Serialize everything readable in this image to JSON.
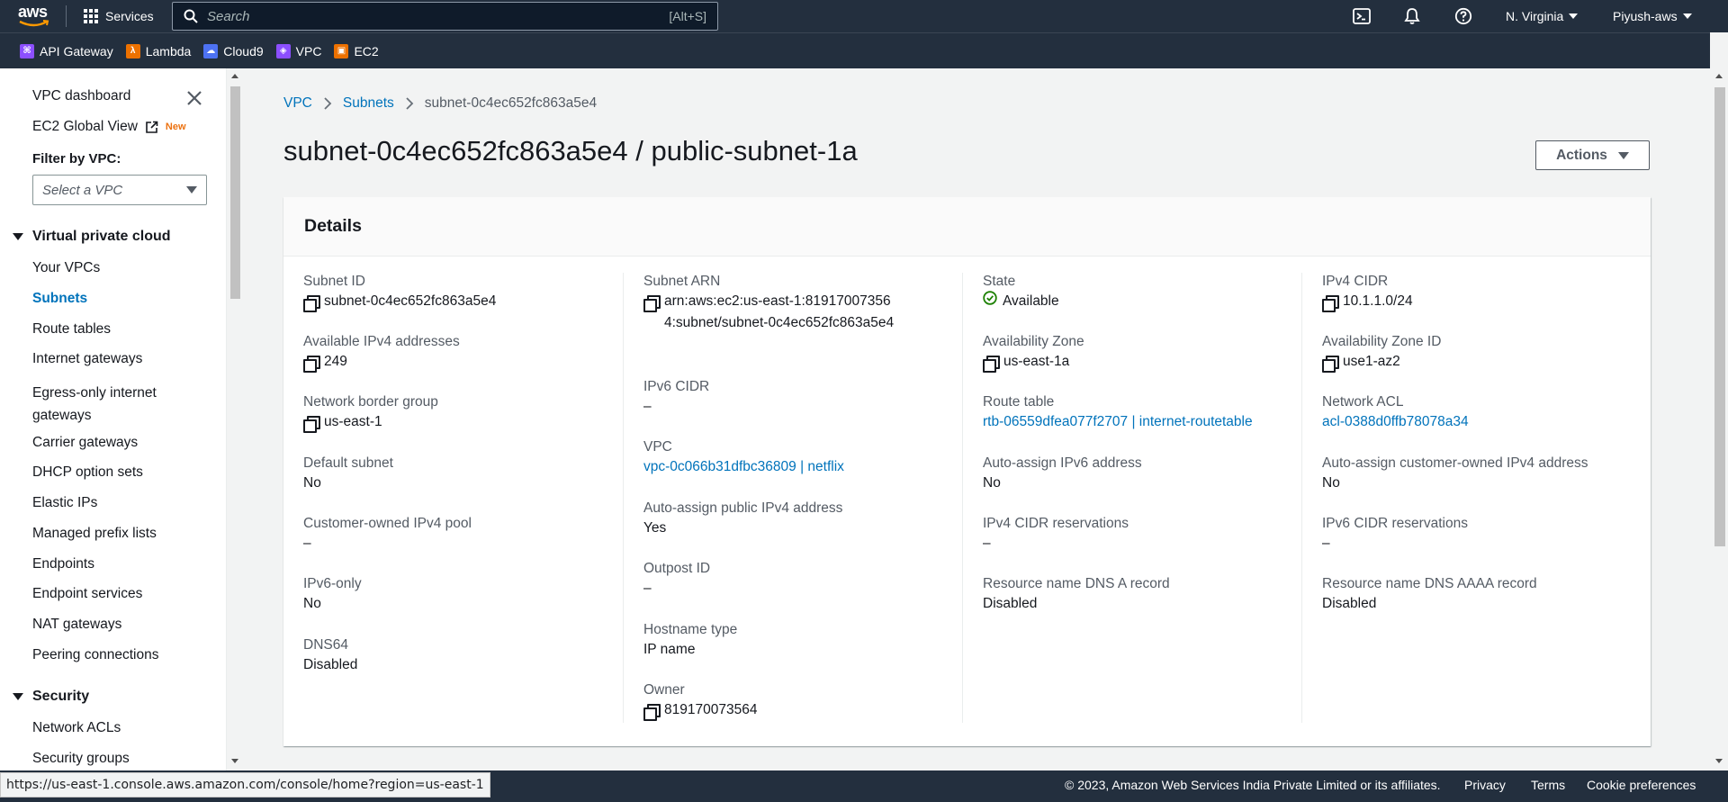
{
  "topbar": {
    "logo": "aws",
    "services_label": "Services",
    "search_placeholder": "Search",
    "search_shortcut": "[Alt+S]",
    "icons": [
      "cloudshell-icon",
      "bell-icon",
      "help-icon"
    ],
    "region": "N. Virginia",
    "account": "Piyush-aws"
  },
  "favorites": [
    {
      "label": "API Gateway",
      "color": "#8c4fff"
    },
    {
      "label": "Lambda",
      "color": "#ed7100"
    },
    {
      "label": "Cloud9",
      "color": "#4d72f3"
    },
    {
      "label": "VPC",
      "color": "#8c4fff"
    },
    {
      "label": "EC2",
      "color": "#ed7100"
    }
  ],
  "sidebar": {
    "dashboard": "VPC dashboard",
    "global_view": "EC2 Global View",
    "new_badge": "New",
    "filter_label": "Filter by VPC:",
    "filter_placeholder": "Select a VPC",
    "section_vpc": "Virtual private cloud",
    "items": [
      "Your VPCs",
      "Subnets",
      "Route tables",
      "Internet gateways",
      "Egress-only internet gateways",
      "Carrier gateways",
      "DHCP option sets",
      "Elastic IPs",
      "Managed prefix lists",
      "Endpoints",
      "Endpoint services",
      "NAT gateways",
      "Peering connections"
    ],
    "active_item": "Subnets",
    "section_security": "Security",
    "security_items": [
      "Network ACLs",
      "Security groups"
    ]
  },
  "breadcrumb": [
    "VPC",
    "Subnets",
    "subnet-0c4ec652fc863a5e4"
  ],
  "page_title": "subnet-0c4ec652fc863a5e4 / public-subnet-1a",
  "actions_label": "Actions",
  "details": {
    "title": "Details",
    "col1": [
      {
        "k": "Subnet ID",
        "v": "subnet-0c4ec652fc863a5e4",
        "copy": true
      },
      {
        "k": "Available IPv4 addresses",
        "v": "249",
        "copy": true
      },
      {
        "k": "Network border group",
        "v": "us-east-1",
        "copy": true
      },
      {
        "k": "Default subnet",
        "v": "No"
      },
      {
        "k": "Customer-owned IPv4 pool",
        "v": "–"
      },
      {
        "k": "IPv6-only",
        "v": "No"
      },
      {
        "k": "DNS64",
        "v": "Disabled"
      }
    ],
    "col2": [
      {
        "k": "Subnet ARN",
        "v": "arn:aws:ec2:us-east-1:819170073564:subnet/subnet-0c4ec652fc863a5e4",
        "copy": true
      },
      {
        "k": "IPv6 CIDR",
        "v": "–"
      },
      {
        "k": "VPC",
        "v": "vpc-0c066b31dfbc36809 | netflix",
        "link": true
      },
      {
        "k": "Auto-assign public IPv4 address",
        "v": "Yes"
      },
      {
        "k": "Outpost ID",
        "v": "–"
      },
      {
        "k": "Hostname type",
        "v": "IP name"
      },
      {
        "k": "Owner",
        "v": "819170073564",
        "copy": true
      }
    ],
    "col3": [
      {
        "k": "State",
        "v": "Available",
        "status": true
      },
      {
        "k": "Availability Zone",
        "v": "us-east-1a",
        "copy": true
      },
      {
        "k": "Route table",
        "v": "rtb-06559dfea077f2707 | internet-routetable",
        "link": true
      },
      {
        "k": "Auto-assign IPv6 address",
        "v": "No"
      },
      {
        "k": "IPv4 CIDR reservations",
        "v": "–"
      },
      {
        "k": "Resource name DNS A record",
        "v": "Disabled"
      }
    ],
    "col4": [
      {
        "k": "IPv4 CIDR",
        "v": "10.1.1.0/24",
        "copy": true
      },
      {
        "k": "Availability Zone ID",
        "v": "use1-az2",
        "copy": true
      },
      {
        "k": "Network ACL",
        "v": "acl-0388d0ffb78078a34",
        "link": true
      },
      {
        "k": "Auto-assign customer-owned IPv4 address",
        "v": "No"
      },
      {
        "k": "IPv6 CIDR reservations",
        "v": "–"
      },
      {
        "k": "Resource name DNS AAAA record",
        "v": "Disabled"
      }
    ]
  },
  "footer": {
    "copyright": "© 2023, Amazon Web Services India Private Limited or its affiliates.",
    "links": [
      "Privacy",
      "Terms",
      "Cookie preferences"
    ]
  },
  "status_url": "https://us-east-1.console.aws.amazon.com/console/home?region=us-east-1"
}
